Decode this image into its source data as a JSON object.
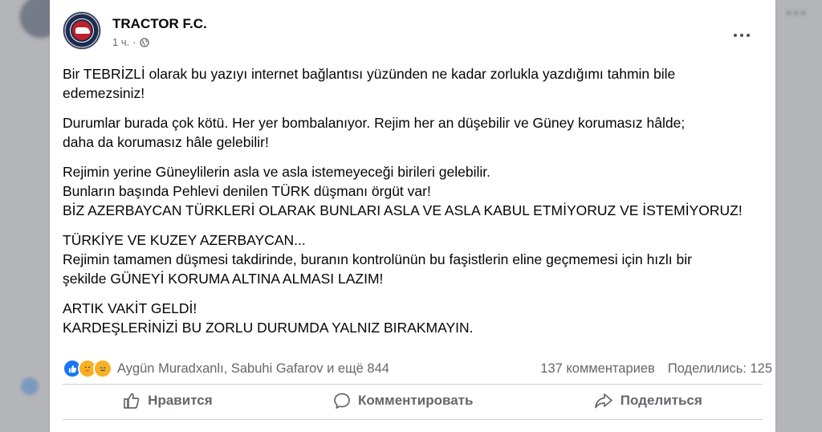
{
  "post": {
    "page_name": "TRACTOR F.C.",
    "time": "1 ч.",
    "visibility_icon": "globe-icon",
    "paragraphs": [
      "Bir TEBRİZLİ olarak bu yazıyı internet bağlantısı yüzünden ne kadar zorlukla yazdığımı tahmin bile\nedemezsiniz!",
      "Durumlar burada çok kötü. Her yer bombalanıyor. Rejim her an düşebilir ve Güney korumasız hâlde;\ndaha da korumasız hâle gelebilir!",
      "Rejimin yerine Güneylilerin asla ve asla istemeyeceği birileri gelebilir.\nBunların başında Pehlevi denilen TÜRK düşmanı örgüt var!\nBİZ AZERBAYCAN TÜRKLERİ OLARAK BUNLARI ASLA VE ASLA KABUL ETMİYORUZ VE İSTEMİYORUZ!",
      "TÜRKİYE VE KUZEY AZERBAYCAN...\nRejimin tamamen düşmesi takdirinde, buranın kontrolünün bu faşistlerin eline geçmemesi için hızlı bir\nşekilde GÜNEYİ KORUMA ALTINA ALMASI LAZIM!",
      "ARTIK VAKİT GELDİ!\nKARDEŞLERİNİZİ BU ZORLU DURUMDA YALNIZ BIRAKMAYIN."
    ]
  },
  "reactions": {
    "icons": [
      "like-icon",
      "care-icon",
      "sad-icon"
    ],
    "names": "Aygün Muradxanlı, Sabuhi Gafarov и ещё 844",
    "comments": "137 комментариев",
    "shares": "Поделились: 125"
  },
  "actions": {
    "like": "Нравится",
    "comment": "Комментировать",
    "share": "Поделиться"
  },
  "colors": {
    "text": "#050505",
    "secondary": "#65676b",
    "like_blue": "#1877f2",
    "reaction_yellow": "#f7b125"
  }
}
